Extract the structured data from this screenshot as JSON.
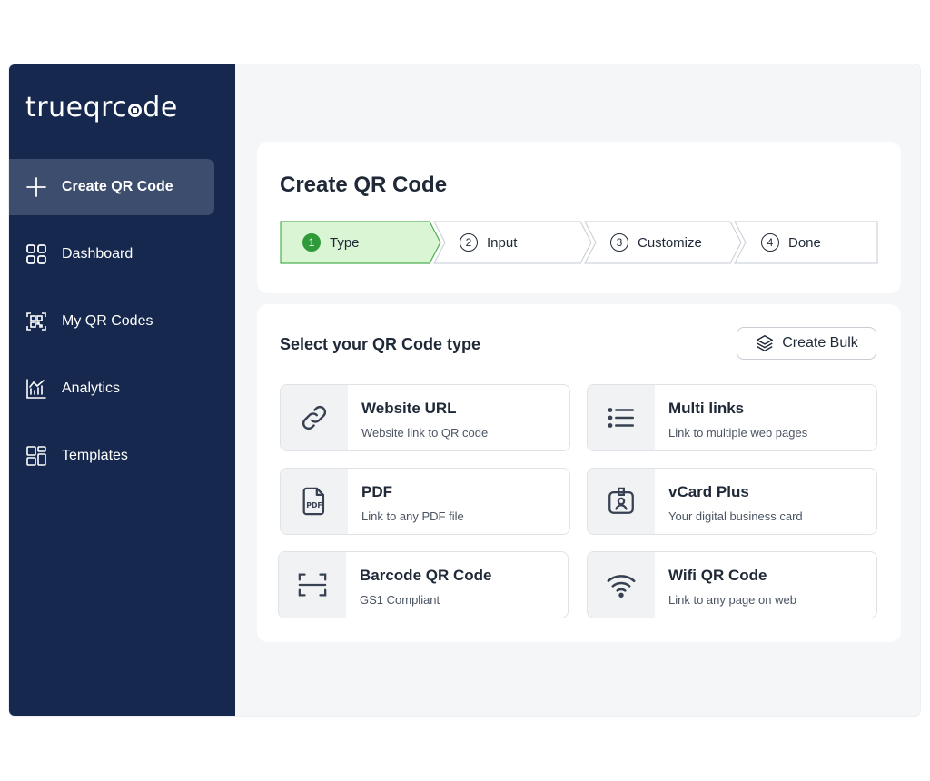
{
  "brand": {
    "logo_text_prefix": "trueqrc",
    "logo_text_suffix": "de"
  },
  "sidebar": {
    "items": [
      {
        "label": "Create QR Code",
        "icon": "plus-icon",
        "active": true
      },
      {
        "label": "Dashboard",
        "icon": "grid-icon",
        "active": false
      },
      {
        "label": "My QR Codes",
        "icon": "qr-code-icon",
        "active": false
      },
      {
        "label": "Analytics",
        "icon": "chart-icon",
        "active": false
      },
      {
        "label": "Templates",
        "icon": "layout-icon",
        "active": false
      }
    ]
  },
  "header": {
    "title": "Create QR Code",
    "steps": [
      {
        "number": "1",
        "label": "Type",
        "active": true
      },
      {
        "number": "2",
        "label": "Input",
        "active": false
      },
      {
        "number": "3",
        "label": "Customize",
        "active": false
      },
      {
        "number": "4",
        "label": "Done",
        "active": false
      }
    ]
  },
  "selection": {
    "title": "Select your QR Code type",
    "bulk_button": "Create Bulk",
    "types": [
      {
        "title": "Website URL",
        "subtitle": "Website link to QR code",
        "icon": "link-icon"
      },
      {
        "title": "Multi links",
        "subtitle": "Link to multiple web pages",
        "icon": "list-icon"
      },
      {
        "title": "PDF",
        "subtitle": "Link to any PDF file",
        "icon": "pdf-icon"
      },
      {
        "title": "vCard Plus",
        "subtitle": "Your digital business card",
        "icon": "id-badge-icon"
      },
      {
        "title": "Barcode QR Code",
        "subtitle": "GS1 Compliant",
        "icon": "barcode-scan-icon"
      },
      {
        "title": "Wifi QR Code",
        "subtitle": "Link to any page on web",
        "icon": "wifi-icon"
      }
    ]
  },
  "colors": {
    "sidebar_bg": "#16284d",
    "sidebar_active": "#3d4d6e",
    "step_active_bg": "#daf5d4",
    "step_active_accent": "#2f9a3a",
    "page_bg": "#f5f6f8"
  }
}
